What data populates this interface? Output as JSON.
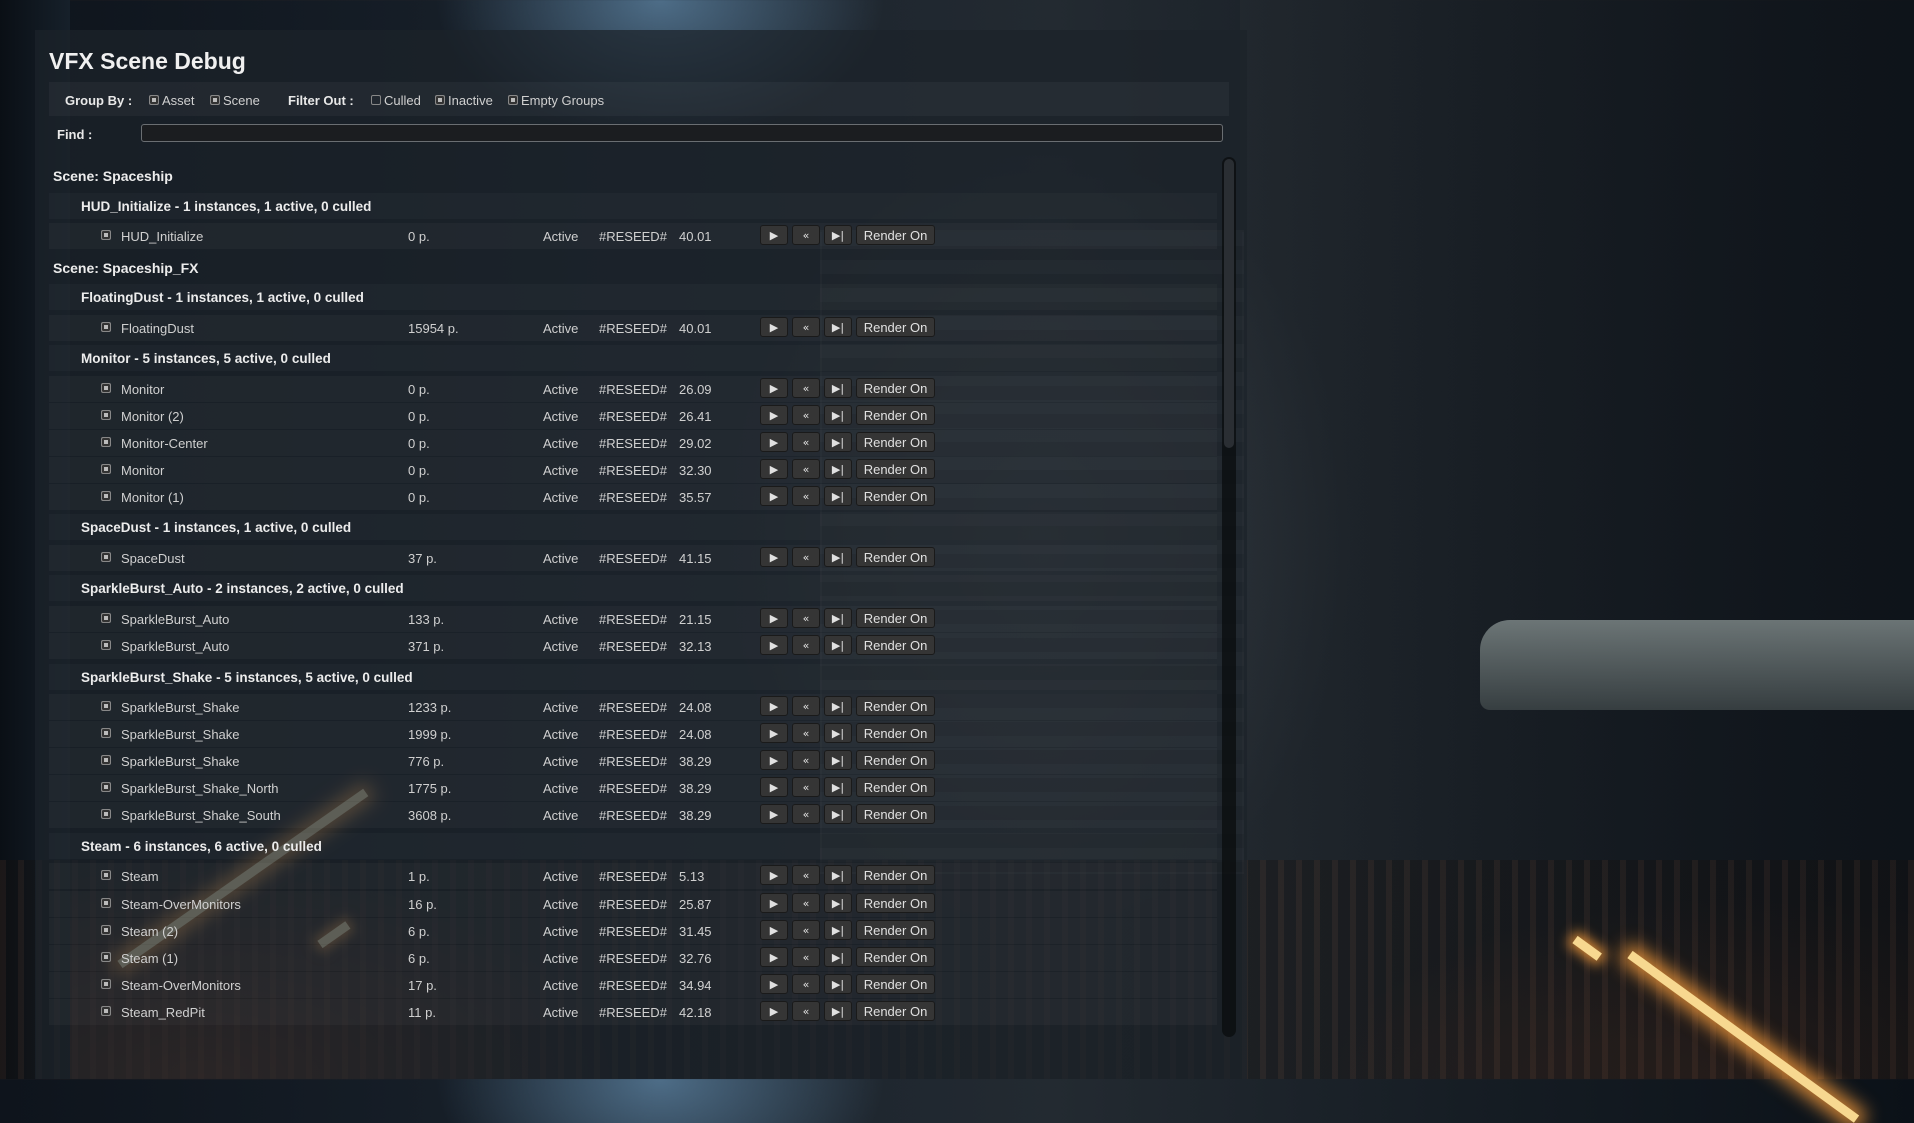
{
  "window": {
    "title": "VFX Scene Debug"
  },
  "toolbar": {
    "group_by_label": "Group By :",
    "group_by_options": [
      {
        "label": "Asset",
        "checked": true
      },
      {
        "label": "Scene",
        "checked": true
      }
    ],
    "filter_out_label": "Filter Out :",
    "filter_out_options": [
      {
        "label": "Culled",
        "checked": false
      },
      {
        "label": "Inactive",
        "checked": true
      },
      {
        "label": "Empty Groups",
        "checked": true
      }
    ],
    "find_label": "Find :",
    "find_value": ""
  },
  "list": [
    {
      "kind": "scene",
      "text": "Scene: Spaceship"
    },
    {
      "kind": "group",
      "text": "HUD_Initialize - 1 instances, 1 active, 0 culled"
    },
    {
      "kind": "item",
      "name": "HUD_Initialize",
      "particles": "0 p.",
      "state": "Active",
      "seed": "#RESEED#",
      "time": "40.01"
    },
    {
      "kind": "scene",
      "text": "Scene: Spaceship_FX"
    },
    {
      "kind": "group",
      "text": "FloatingDust - 1 instances, 1 active, 0 culled"
    },
    {
      "kind": "item",
      "name": "FloatingDust",
      "particles": "15954 p.",
      "state": "Active",
      "seed": "#RESEED#",
      "time": "40.01"
    },
    {
      "kind": "group",
      "text": "Monitor - 5 instances, 5 active, 0 culled"
    },
    {
      "kind": "item",
      "name": "Monitor",
      "particles": "0 p.",
      "state": "Active",
      "seed": "#RESEED#",
      "time": "26.09"
    },
    {
      "kind": "item",
      "name": "Monitor (2)",
      "particles": "0 p.",
      "state": "Active",
      "seed": "#RESEED#",
      "time": "26.41"
    },
    {
      "kind": "item",
      "name": "Monitor-Center",
      "particles": "0 p.",
      "state": "Active",
      "seed": "#RESEED#",
      "time": "29.02"
    },
    {
      "kind": "item",
      "name": "Monitor",
      "particles": "0 p.",
      "state": "Active",
      "seed": "#RESEED#",
      "time": "32.30"
    },
    {
      "kind": "item",
      "name": "Monitor (1)",
      "particles": "0 p.",
      "state": "Active",
      "seed": "#RESEED#",
      "time": "35.57"
    },
    {
      "kind": "group",
      "text": "SpaceDust - 1 instances, 1 active, 0 culled"
    },
    {
      "kind": "item",
      "name": "SpaceDust",
      "particles": "37 p.",
      "state": "Active",
      "seed": "#RESEED#",
      "time": "41.15"
    },
    {
      "kind": "group",
      "text": "SparkleBurst_Auto - 2 instances, 2 active, 0 culled"
    },
    {
      "kind": "item",
      "name": "SparkleBurst_Auto",
      "particles": "133 p.",
      "state": "Active",
      "seed": "#RESEED#",
      "time": "21.15"
    },
    {
      "kind": "item",
      "name": "SparkleBurst_Auto",
      "particles": "371 p.",
      "state": "Active",
      "seed": "#RESEED#",
      "time": "32.13"
    },
    {
      "kind": "group",
      "text": "SparkleBurst_Shake - 5 instances, 5 active, 0 culled"
    },
    {
      "kind": "item",
      "name": "SparkleBurst_Shake",
      "particles": "1233 p.",
      "state": "Active",
      "seed": "#RESEED#",
      "time": "24.08"
    },
    {
      "kind": "item",
      "name": "SparkleBurst_Shake",
      "particles": "1999 p.",
      "state": "Active",
      "seed": "#RESEED#",
      "time": "24.08"
    },
    {
      "kind": "item",
      "name": "SparkleBurst_Shake",
      "particles": "776 p.",
      "state": "Active",
      "seed": "#RESEED#",
      "time": "38.29"
    },
    {
      "kind": "item",
      "name": "SparkleBurst_Shake_North",
      "particles": "1775 p.",
      "state": "Active",
      "seed": "#RESEED#",
      "time": "38.29"
    },
    {
      "kind": "item",
      "name": "SparkleBurst_Shake_South",
      "particles": "3608 p.",
      "state": "Active",
      "seed": "#RESEED#",
      "time": "38.29"
    },
    {
      "kind": "group",
      "text": "Steam - 6 instances, 6 active, 0 culled"
    },
    {
      "kind": "item",
      "name": "Steam",
      "particles": "1 p.",
      "state": "Active",
      "seed": "#RESEED#",
      "time": "5.13"
    },
    {
      "kind": "item",
      "name": "Steam-OverMonitors",
      "particles": "16 p.",
      "state": "Active",
      "seed": "#RESEED#",
      "time": "25.87"
    },
    {
      "kind": "item",
      "name": "Steam (2)",
      "particles": "6 p.",
      "state": "Active",
      "seed": "#RESEED#",
      "time": "31.45"
    },
    {
      "kind": "item",
      "name": "Steam (1)",
      "particles": "6 p.",
      "state": "Active",
      "seed": "#RESEED#",
      "time": "32.76"
    },
    {
      "kind": "item",
      "name": "Steam-OverMonitors",
      "particles": "17 p.",
      "state": "Active",
      "seed": "#RESEED#",
      "time": "34.94"
    },
    {
      "kind": "item",
      "name": "Steam_RedPit",
      "particles": "11 p.",
      "state": "Active",
      "seed": "#RESEED#",
      "time": "42.18"
    }
  ],
  "item_buttons": {
    "play": "▶",
    "restart": "«",
    "step": "▶|",
    "render": "Render On"
  },
  "scroll": {
    "thumb_fraction": 0.33,
    "position": 0
  }
}
